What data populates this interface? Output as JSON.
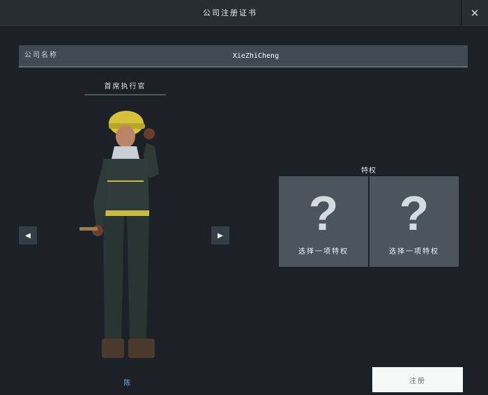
{
  "dialog": {
    "title": "公司注册证书",
    "close_symbol": "✕"
  },
  "company": {
    "label": "公司名称",
    "value": "XieZhiCheng"
  },
  "ceo": {
    "header": "首席执行官",
    "prev_symbol": "◀",
    "next_symbol": "▶",
    "character_name": "陈"
  },
  "perks": {
    "label": "特权",
    "slots": [
      {
        "symbol": "?",
        "label": "选择一项特权"
      },
      {
        "symbol": "?",
        "label": "选择一项特权"
      }
    ]
  },
  "register": {
    "label": "注册"
  },
  "colors": {
    "background": "#1b2126",
    "panel": "#4a555d",
    "accent_name": "#6bb3ff"
  }
}
